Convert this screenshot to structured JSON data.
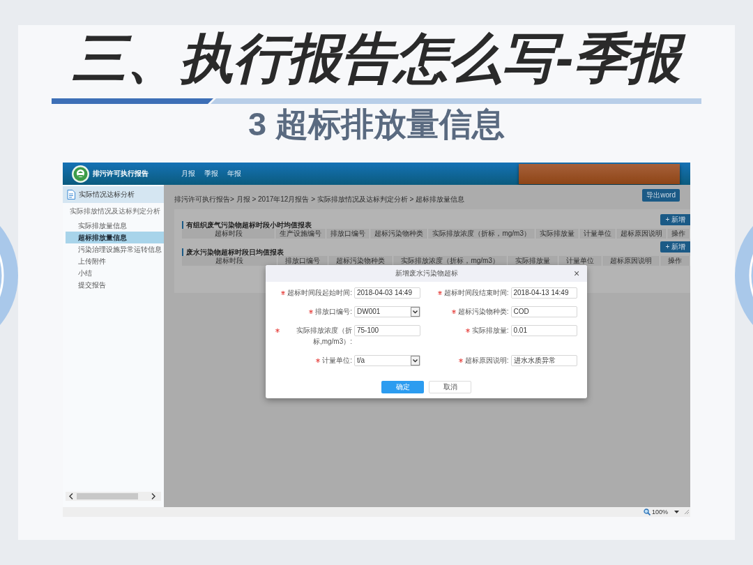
{
  "slide": {
    "title": "三、执行报告怎么写-季报",
    "subtitle": "3 超标排放量信息"
  },
  "app": {
    "header": {
      "title": "排污许可执行报告",
      "nav": [
        {
          "label": "月报"
        },
        {
          "label": "季报"
        },
        {
          "label": "年报"
        }
      ]
    },
    "sidebar": {
      "section": "实际情况达标分析",
      "group": "实际排放情况及达标判定分析",
      "items": [
        {
          "label": "实际排放量信息",
          "selected": false
        },
        {
          "label": "超标排放量信息",
          "selected": true
        },
        {
          "label": "污染治理设施异常运转信息",
          "selected": false
        },
        {
          "label": "上传附件",
          "selected": false
        },
        {
          "label": "小结",
          "selected": false
        },
        {
          "label": "提交报告",
          "selected": false
        }
      ]
    },
    "breadcrumb": "排污许可执行报告> 月报 > 2017年12月报告 > 实际排放情况及达标判定分析 > 超标排放量信息",
    "export_button": "导出word",
    "tables": [
      {
        "title": "有组织废气污染物超标时段小时均值报表",
        "add_button": "+ 新增",
        "columns": [
          "超标时段",
          "生产设施编号",
          "排放口编号",
          "超标污染物种类",
          "实际排放浓度（折标，mg/m3）",
          "实际排放量",
          "计量单位",
          "超标原因说明",
          "操作"
        ]
      },
      {
        "title": "废水污染物超标时段日均值报表",
        "add_button": "+ 新增",
        "columns": [
          "超标时段",
          "排放口编号",
          "超标污染物种类",
          "实际排放浓度（折标，mg/m3）",
          "实际排放量",
          "计量单位",
          "超标原因说明",
          "操作"
        ]
      }
    ],
    "dialog": {
      "title": "新增废水污染物超标",
      "close": "×",
      "fields": [
        {
          "label": "超标时间段起始时间:",
          "required": true,
          "kind": "text",
          "value": "2018-04-03 14:49"
        },
        {
          "label": "超标时间段结束时间:",
          "required": true,
          "kind": "text",
          "value": "2018-04-13 14:49"
        },
        {
          "label": "排放口编号:",
          "required": true,
          "kind": "select",
          "value": "DW001"
        },
        {
          "label": "超标污染物种类:",
          "required": true,
          "kind": "text",
          "value": "COD"
        },
        {
          "label": "实际排放浓度（折标,mg/m3）:",
          "required": true,
          "kind": "text",
          "value": "75-100"
        },
        {
          "label": "实际排放量:",
          "required": true,
          "kind": "text",
          "value": "0.01"
        },
        {
          "label": "计量单位:",
          "required": true,
          "kind": "select",
          "value": "t/a"
        },
        {
          "label": "超标原因说明:",
          "required": true,
          "kind": "text",
          "value": "进水水质异常"
        }
      ],
      "buttons": [
        {
          "label": "确定",
          "kind": "primary"
        },
        {
          "label": "取消",
          "kind": "secondary"
        }
      ]
    },
    "status_bar": {
      "zoom": "100%"
    }
  }
}
